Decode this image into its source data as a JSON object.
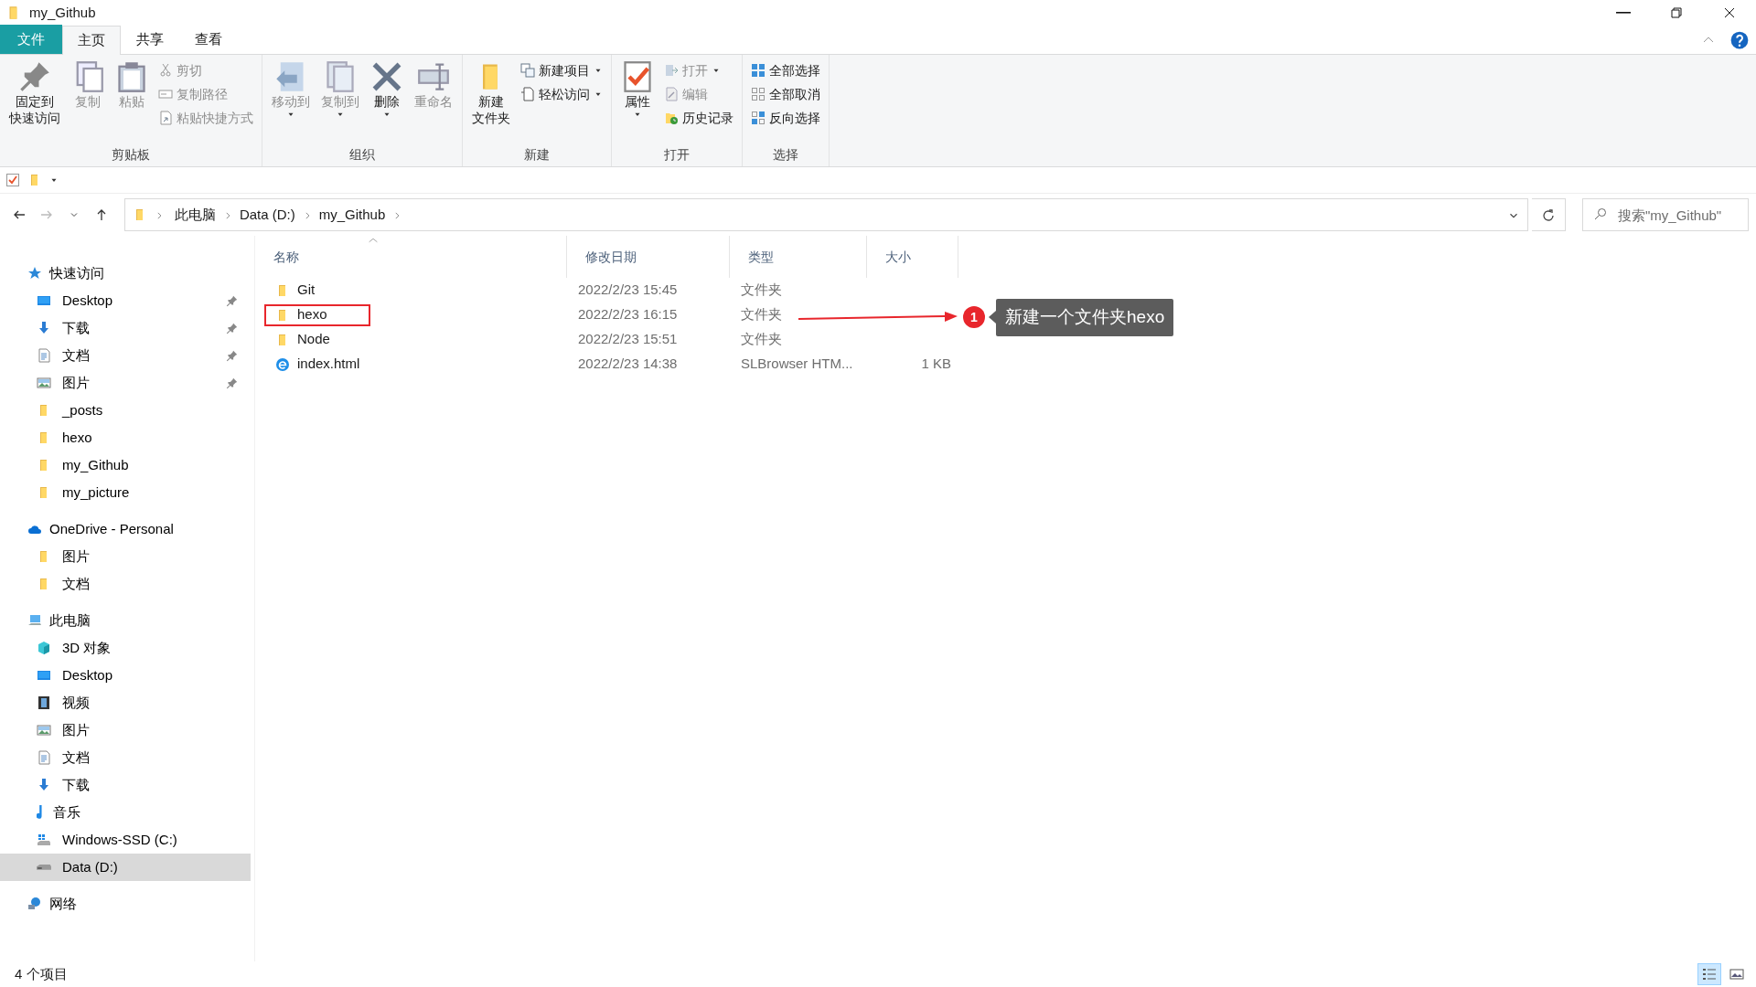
{
  "window": {
    "title": "my_Github"
  },
  "tabs": [
    {
      "label": "文件",
      "kind": "file",
      "selected": false
    },
    {
      "label": "主页",
      "kind": "tab",
      "selected": true
    },
    {
      "label": "共享",
      "kind": "tab",
      "selected": false
    },
    {
      "label": "查看",
      "kind": "tab",
      "selected": false
    }
  ],
  "ribbon": {
    "groups": [
      {
        "label": "剪贴板",
        "buttons": [
          {
            "kind": "large",
            "lines": [
              "固定到",
              "快速访问"
            ],
            "disabled": false,
            "dropdown": false
          },
          {
            "kind": "large",
            "lines": [
              "复制"
            ],
            "disabled": true,
            "dropdown": false
          },
          {
            "kind": "large",
            "lines": [
              "粘贴"
            ],
            "disabled": true,
            "dropdown": false
          },
          {
            "kind": "small",
            "label": "剪切",
            "disabled": true,
            "dropdown": false
          },
          {
            "kind": "small",
            "label": "复制路径",
            "disabled": true,
            "dropdown": false
          },
          {
            "kind": "small",
            "label": "粘贴快捷方式",
            "disabled": true,
            "dropdown": false
          }
        ]
      },
      {
        "label": "组织",
        "buttons": [
          {
            "kind": "large",
            "lines": [
              "移动到"
            ],
            "disabled": true,
            "dropdown": true
          },
          {
            "kind": "large",
            "lines": [
              "复制到"
            ],
            "disabled": true,
            "dropdown": true
          },
          {
            "kind": "large",
            "lines": [
              "删除"
            ],
            "disabled": false,
            "dropdown": true
          },
          {
            "kind": "large",
            "lines": [
              "重命名"
            ],
            "disabled": true,
            "dropdown": false
          }
        ]
      },
      {
        "label": "新建",
        "buttons": [
          {
            "kind": "large",
            "lines": [
              "新建",
              "文件夹"
            ],
            "disabled": false,
            "dropdown": false
          },
          {
            "kind": "small",
            "label": "新建项目",
            "disabled": false,
            "dropdown": true
          },
          {
            "kind": "small",
            "label": "轻松访问",
            "disabled": false,
            "dropdown": true
          }
        ]
      },
      {
        "label": "打开",
        "buttons": [
          {
            "kind": "large",
            "lines": [
              "属性"
            ],
            "disabled": false,
            "dropdown": true
          },
          {
            "kind": "small",
            "label": "打开",
            "disabled": true,
            "dropdown": true
          },
          {
            "kind": "small",
            "label": "编辑",
            "disabled": true,
            "dropdown": false
          },
          {
            "kind": "small",
            "label": "历史记录",
            "disabled": false,
            "dropdown": false
          }
        ]
      },
      {
        "label": "选择",
        "buttons": [
          {
            "kind": "small",
            "label": "全部选择",
            "disabled": false,
            "dropdown": false
          },
          {
            "kind": "small",
            "label": "全部取消",
            "disabled": false,
            "dropdown": false
          },
          {
            "kind": "small",
            "label": "反向选择",
            "disabled": false,
            "dropdown": false
          }
        ]
      }
    ]
  },
  "address": {
    "breadcrumbs": [
      "此电脑",
      "Data (D:)",
      "my_Github"
    ],
    "search_placeholder": "搜索\"my_Github\""
  },
  "sidebar": {
    "sections": [
      {
        "label": "快速访问",
        "children": [
          {
            "label": "Desktop",
            "pinned": true,
            "selected": false
          },
          {
            "label": "下载",
            "pinned": true,
            "selected": false
          },
          {
            "label": "文档",
            "pinned": true,
            "selected": false
          },
          {
            "label": "图片",
            "pinned": true,
            "selected": false
          },
          {
            "label": "_posts",
            "pinned": false,
            "selected": false
          },
          {
            "label": "hexo",
            "pinned": false,
            "selected": false
          },
          {
            "label": "my_Github",
            "pinned": false,
            "selected": false
          },
          {
            "label": "my_picture",
            "pinned": false,
            "selected": false
          }
        ]
      },
      {
        "label": "OneDrive - Personal",
        "children": [
          {
            "label": "图片",
            "pinned": false,
            "selected": false
          },
          {
            "label": "文档",
            "pinned": false,
            "selected": false
          }
        ]
      },
      {
        "label": "此电脑",
        "children": [
          {
            "label": "3D 对象",
            "pinned": false,
            "selected": false
          },
          {
            "label": "Desktop",
            "pinned": false,
            "selected": false
          },
          {
            "label": "视频",
            "pinned": false,
            "selected": false
          },
          {
            "label": "图片",
            "pinned": false,
            "selected": false
          },
          {
            "label": "文档",
            "pinned": false,
            "selected": false
          },
          {
            "label": "下载",
            "pinned": false,
            "selected": false
          },
          {
            "label": "音乐",
            "pinned": false,
            "selected": false
          },
          {
            "label": "Windows-SSD (C:)",
            "pinned": false,
            "selected": false
          },
          {
            "label": "Data (D:)",
            "pinned": false,
            "selected": true
          }
        ]
      },
      {
        "label": "网络"
      }
    ]
  },
  "file_list": {
    "columns": [
      "名称",
      "修改日期",
      "类型",
      "大小"
    ],
    "rows": [
      {
        "kind": "folder",
        "name": "Git",
        "modified": "2022/2/23 15:45",
        "type": "文件夹",
        "highlighted": false
      },
      {
        "kind": "folder",
        "name": "hexo",
        "modified": "2022/2/23 16:15",
        "type": "文件夹",
        "highlighted": true
      },
      {
        "kind": "folder",
        "name": "Node",
        "modified": "2022/2/23 15:51",
        "type": "文件夹",
        "highlighted": false
      },
      {
        "kind": "file",
        "name": "index.html",
        "modified": "2022/2/23 14:38",
        "type": "SLBrowser HTM...",
        "size": "1 KB",
        "highlighted": false
      }
    ]
  },
  "annotation": {
    "number": "1",
    "text": "新建一个文件夹hexo"
  },
  "status_bar": {
    "text": "4 个项目",
    "view_buttons": [
      {
        "selected": true
      },
      {
        "selected": false
      }
    ]
  }
}
